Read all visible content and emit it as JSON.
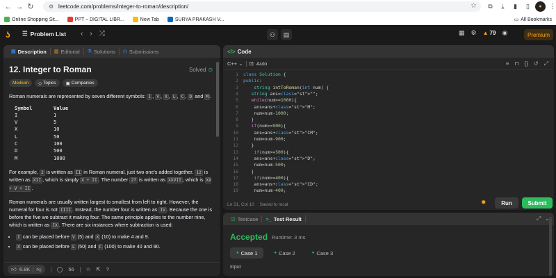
{
  "browser": {
    "url": "leetcode.com/problems/integer-to-roman/description/",
    "bookmarks": [
      {
        "label": "Online Shopping Sit...",
        "color": "#4caf50"
      },
      {
        "label": "PPT – DIGITAL LIBR...",
        "color": "#e53935"
      },
      {
        "label": "New Tab",
        "color": "#fbbc04"
      },
      {
        "label": "SURYA PRAKASH V...",
        "color": "#0a66c2"
      }
    ],
    "all_bookmarks": "All Bookmarks"
  },
  "topbar": {
    "problem_list": "Problem List",
    "streak": "79",
    "premium": "Premium"
  },
  "left_tabs": [
    "Description",
    "Editorial",
    "Solutions",
    "Submissions"
  ],
  "problem": {
    "title": "12. Integer to Roman",
    "solved": "Solved",
    "difficulty": "Medium",
    "topics": "Topics",
    "companies": "Companies",
    "intro_pre": "Roman numerals are represented by seven different symbols: ",
    "intro_syms": [
      "I",
      "V",
      "X",
      "L",
      "C",
      "D",
      "M"
    ],
    "intro_and": "and",
    "table_header": {
      "symbol": "Symbol",
      "value": "Value"
    },
    "table_rows": [
      {
        "s": "I",
        "v": "1"
      },
      {
        "s": "V",
        "v": "5"
      },
      {
        "s": "X",
        "v": "10"
      },
      {
        "s": "L",
        "v": "50"
      },
      {
        "s": "C",
        "v": "100"
      },
      {
        "s": "D",
        "v": "500"
      },
      {
        "s": "M",
        "v": "1000"
      }
    ],
    "p2": {
      "a": "For example, ",
      "c2": "2",
      "b": " is written as ",
      "cII": "II",
      "c": " in Roman numeral, just two one's added together. ",
      "c12": "12",
      "d": " is",
      "e": "written as ",
      "cXII": "XII",
      "f": ", which is simply ",
      "cXpII": "X + II",
      "g": ". The number ",
      "c27": "27",
      "h": " is written as ",
      "cXXVII": "XXVII",
      "i": ", which is",
      "cXXVII2": "XX + V + II",
      "j": "."
    },
    "p3": {
      "a": "Roman numerals are usually written largest to smallest from left to right. However, the",
      "b": "numeral for four is not ",
      "cIIII": "IIII",
      "c": ". Instead, the number four is written as ",
      "cIV": "IV",
      "d": ". Because the one",
      "e": "is before the five we subtract it making four. The same principle applies to the number",
      "f": "nine, which is written as ",
      "cIX": "IX",
      "g": ". There are six instances where subtraction is used:"
    },
    "bullets": [
      {
        "c": "I",
        "a": " can be placed before ",
        "x": "V",
        "b": " (5) and ",
        "y": "X",
        "d": " (10) to make 4 and 9."
      },
      {
        "c": "X",
        "a": " can be placed before ",
        "x": "L",
        "b": " (50) and ",
        "y": "C",
        "d": " (100) to make 40 and 90."
      }
    ]
  },
  "left_footer": {
    "likes": "6.8K",
    "comments": "56"
  },
  "code": {
    "header": "Code",
    "language": "C++",
    "auto": "Auto",
    "status": "Ln 21, Col 10",
    "saved": "Saved to local",
    "lines": [
      "class Solution {",
      "public:",
      "    string intToRoman(int num) {",
      "   string ans=\"\";",
      "   while(num>=1000){",
      "    ans=ans+\"M\";",
      "    num=num-1000;",
      "   }",
      "   if(num>=900){",
      "    ans=ans+\"CM\";",
      "    num=num-900;",
      "   }",
      "    if(num>=500){",
      "    ans=ans+\"D\";",
      "    num=num-500;",
      "   }",
      "    if(num>=400){",
      "    ans=ans+\"CD\";",
      "    num=num-400;"
    ]
  },
  "actions": {
    "run": "Run",
    "submit": "Submit"
  },
  "test": {
    "tab_testcase": "Testcase",
    "tab_result": "Test Result",
    "accepted": "Accepted",
    "runtime": "Runtime: 3 ms",
    "cases": [
      "Case 1",
      "Case 2",
      "Case 3"
    ],
    "input_label": "Input"
  }
}
